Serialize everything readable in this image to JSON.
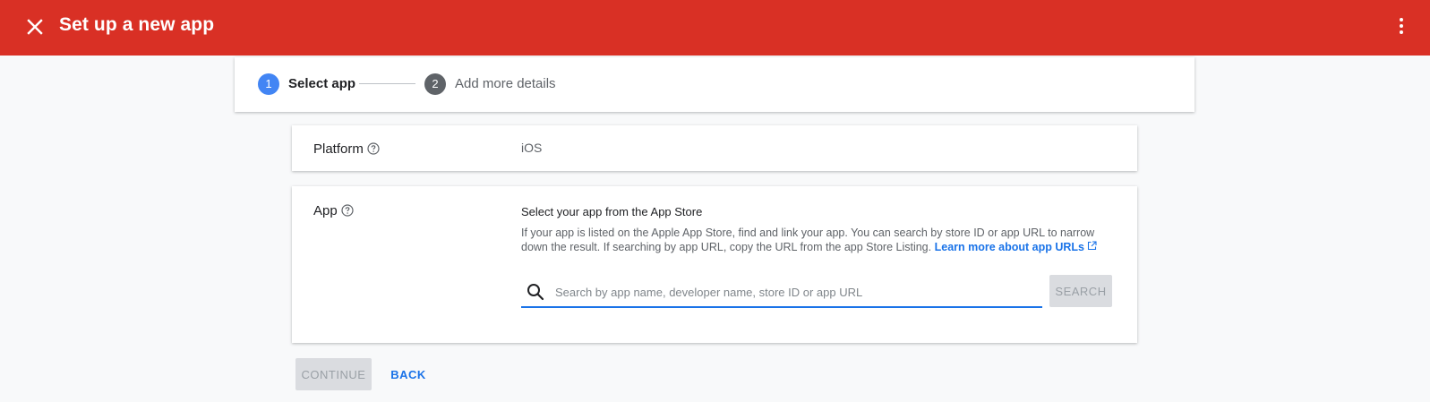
{
  "header": {
    "title": "Set up a new app",
    "close_icon": "close-icon",
    "menu_icon": "more-vert-icon",
    "background_color": "#d93025"
  },
  "stepper": {
    "steps": [
      {
        "number": "1",
        "label": "Select app",
        "state": "active",
        "color": "#4285f4"
      },
      {
        "number": "2",
        "label": "Add more details",
        "state": "inactive",
        "color": "#5f6368"
      }
    ]
  },
  "platform": {
    "label": "Platform",
    "value": "iOS"
  },
  "app": {
    "label": "App",
    "heading": "Select your app from the App Store",
    "description": "If your app is listed on the Apple App Store, find and link your app. You can search by store ID or app URL to narrow down the result. If searching by app URL, copy the URL from the app Store Listing.",
    "learn_more": "Learn more about app URLs",
    "search_placeholder": "Search by app name, developer name, store ID or app URL",
    "search_value": "",
    "search_button": "SEARCH"
  },
  "actions": {
    "continue": "CONTINUE",
    "back": "BACK"
  },
  "colors": {
    "accent": "#1a73e8",
    "disabled_bg": "#dadce0",
    "disabled_text": "#9aa0a6"
  }
}
